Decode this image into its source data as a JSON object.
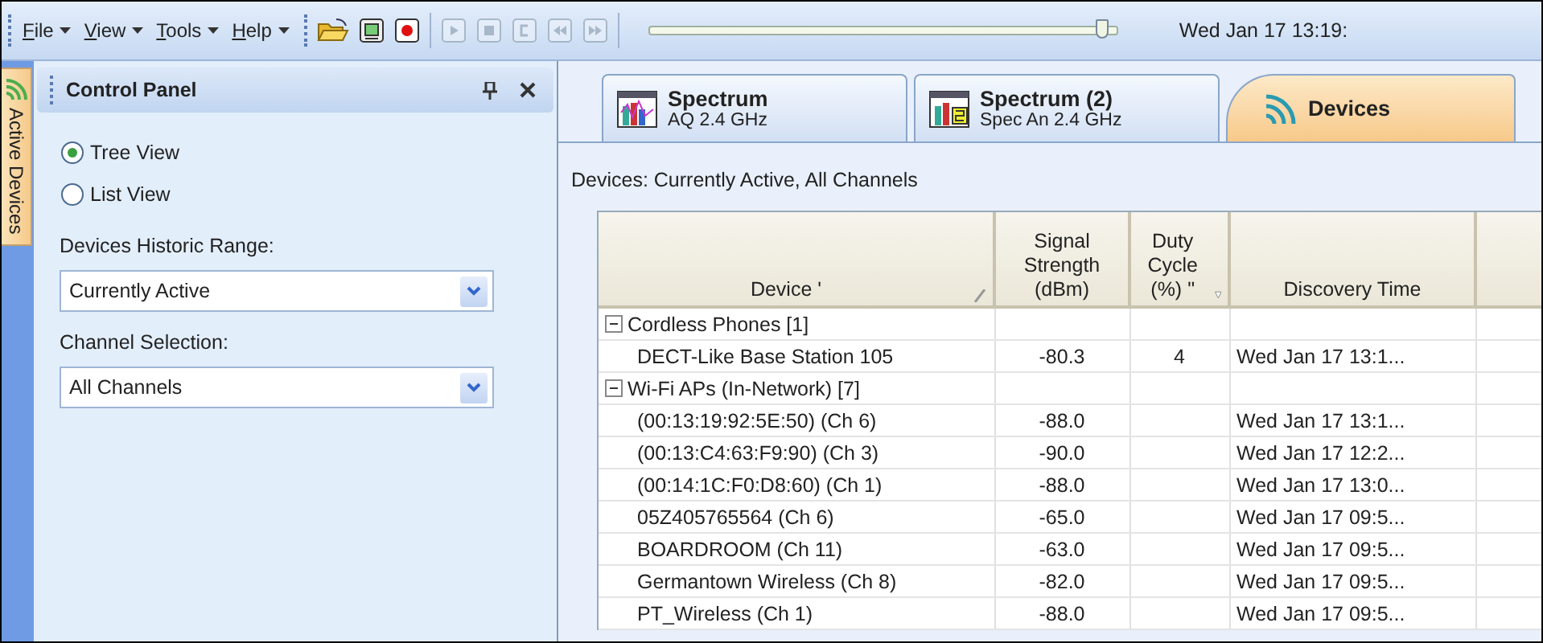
{
  "toolbar": {
    "menus": [
      {
        "label": "File"
      },
      {
        "label": "View"
      },
      {
        "label": "Tools"
      },
      {
        "label": "Help"
      }
    ],
    "buttons": [
      {
        "kind": "open",
        "disabled": false
      },
      {
        "kind": "export",
        "disabled": false
      },
      {
        "kind": "record",
        "disabled": false
      },
      {
        "kind": "play",
        "disabled": true
      },
      {
        "kind": "stop",
        "disabled": true
      },
      {
        "kind": "loop",
        "disabled": true
      },
      {
        "kind": "rewind",
        "disabled": true
      },
      {
        "kind": "forward",
        "disabled": true
      }
    ],
    "timeline": {
      "level": 0.97
    },
    "clock": "Wed Jan 17 13:19:"
  },
  "side_tab": {
    "label": "Active Devices"
  },
  "control_panel": {
    "title": "Control Panel",
    "views": [
      {
        "label": "Tree View",
        "selected": true
      },
      {
        "label": "List View",
        "selected": false
      }
    ],
    "historic_range": {
      "label": "Devices Historic Range:",
      "value": "Currently Active"
    },
    "channel_selection": {
      "label": "Channel Selection:",
      "value": "All Channels"
    }
  },
  "tabs": [
    {
      "kind": "spectrum",
      "title": "Spectrum",
      "subtitle": "AQ 2.4 GHz",
      "selected": false
    },
    {
      "kind": "spectrum2",
      "title": "Spectrum (2)",
      "subtitle": "Spec An 2.4 GHz",
      "selected": false
    },
    {
      "kind": "devices",
      "title": "Devices",
      "selected": true
    }
  ],
  "filter_caption": "Devices: Currently Active, All Channels",
  "table": {
    "columns": [
      {
        "label": "Device '",
        "kind": "sort"
      },
      {
        "label": "Signal Strength (dBm)"
      },
      {
        "label": "Duty Cycle (%) \"",
        "kind": "filter"
      },
      {
        "label": "Discovery Time"
      },
      {
        "kind": "cut"
      }
    ],
    "rows": [
      {
        "label": "Cordless Phones [1]",
        "expanded": true,
        "children": [
          {
            "device": "DECT-Like Base Station 105",
            "signal": "-80.3",
            "duty": "4",
            "discovery": "Wed Jan 17 13:1..."
          }
        ]
      },
      {
        "label": "Wi-Fi APs (In-Network) [7]",
        "expanded": true,
        "children": [
          {
            "device": "(00:13:19:92:5E:50) (Ch 6)",
            "signal": "-88.0",
            "discovery": "Wed Jan 17 13:1..."
          },
          {
            "device": "(00:13:C4:63:F9:90) (Ch 3)",
            "signal": "-90.0",
            "discovery": "Wed Jan 17 12:2..."
          },
          {
            "device": "(00:14:1C:F0:D8:60) (Ch 1)",
            "signal": "-88.0",
            "discovery": "Wed Jan 17 13:0..."
          },
          {
            "device": "05Z405765564 (Ch 6)",
            "signal": "-65.0",
            "discovery": "Wed Jan 17 09:5..."
          },
          {
            "device": "BOARDROOM (Ch 11)",
            "signal": "-63.0",
            "discovery": "Wed Jan 17 09:5..."
          },
          {
            "device": "Germantown Wireless (Ch 8)",
            "signal": "-82.0",
            "discovery": "Wed Jan 17 09:5..."
          },
          {
            "device": "PT_Wireless (Ch 1)",
            "signal": "-88.0",
            "discovery": "Wed Jan 17 09:5..."
          }
        ]
      }
    ]
  }
}
